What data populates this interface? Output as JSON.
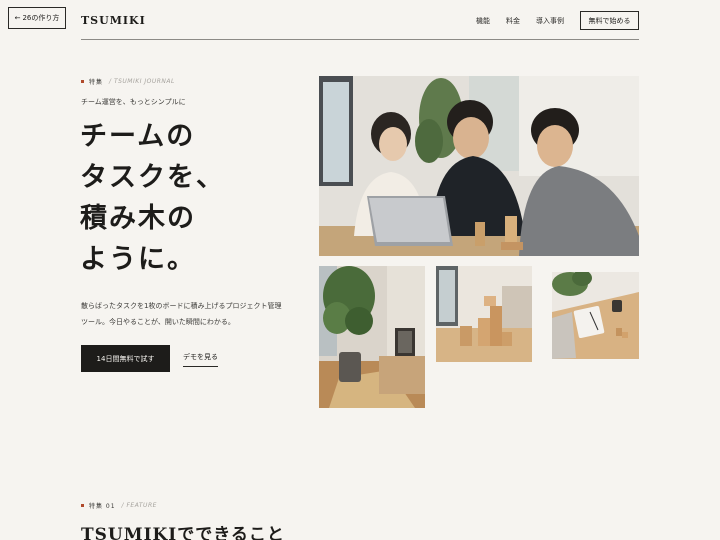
{
  "back_button": {
    "label": "26の作り方",
    "icon": "arrow-left-icon"
  },
  "header": {
    "logo": "TSUMIKI",
    "nav": [
      "機能",
      "料金",
      "導入事例"
    ],
    "cta": "無料で始める"
  },
  "hero": {
    "eyebrow_label": "特集",
    "eyebrow_sub": "/ TSUMIKI JOURNAL",
    "tagline": "チーム運営を、もっとシンプルに",
    "title_lines": [
      "チームの",
      "タスクを、",
      "積み木の",
      "ように。"
    ],
    "desc_lines": [
      "散らばったタスクを1枚のボードに積み上げるプロジェクト管理",
      "ツール。今日やることが、開いた瞬間にわかる。"
    ],
    "primary_cta": "14日間無料で試す",
    "secondary_cta": "デモを見る"
  },
  "feature": {
    "eyebrow_label": "特集 01",
    "eyebrow_sub": "/ FEATURE",
    "title": "TSUMIKIでできること"
  },
  "colors": {
    "background": "#f6f4f0",
    "ink": "#1d1c1a",
    "accent": "#b04a2c"
  }
}
